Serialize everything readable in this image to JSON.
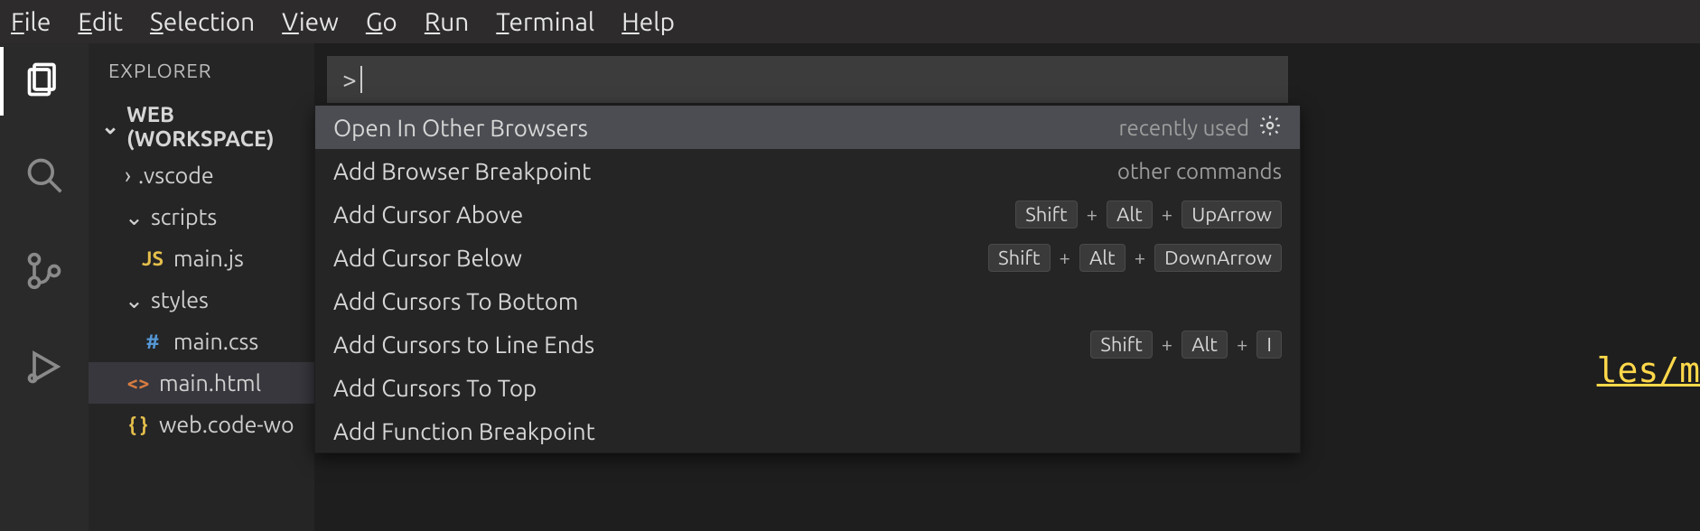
{
  "menubar": {
    "items": [
      "File",
      "Edit",
      "Selection",
      "View",
      "Go",
      "Run",
      "Terminal",
      "Help"
    ]
  },
  "activitybar": {
    "items": [
      {
        "name": "explorer-icon",
        "active": true
      },
      {
        "name": "search-icon",
        "active": false
      },
      {
        "name": "source-control-icon",
        "active": false
      },
      {
        "name": "run-debug-icon",
        "active": false
      }
    ]
  },
  "sidebar": {
    "title": "EXPLORER",
    "section_label": "WEB (WORKSPACE)",
    "tree": [
      {
        "kind": "folder",
        "name": ".vscode",
        "expanded": false,
        "depth": 1
      },
      {
        "kind": "folder",
        "name": "scripts",
        "expanded": true,
        "depth": 1
      },
      {
        "kind": "file",
        "name": "main.js",
        "icon": "JS",
        "icon_class": "ic-js",
        "depth": 2
      },
      {
        "kind": "folder",
        "name": "styles",
        "expanded": true,
        "depth": 1
      },
      {
        "kind": "file",
        "name": "main.css",
        "icon": "#",
        "icon_class": "ic-css",
        "depth": 2
      },
      {
        "kind": "file",
        "name": "main.html",
        "icon": "<>",
        "icon_class": "ic-html",
        "depth": 1,
        "selected": true
      },
      {
        "kind": "file",
        "name": "web.code-workspace",
        "display": "web.code-wo",
        "icon": "{ }",
        "icon_class": "ic-json",
        "depth": 1
      }
    ]
  },
  "command_palette": {
    "prefix": ">",
    "hint_recent": "recently used",
    "hint_other": "other commands",
    "items": [
      {
        "label": "Open In Other Browsers",
        "selected": true,
        "right_hint": "recent",
        "gear": true
      },
      {
        "label": "Add Browser Breakpoint",
        "right_hint": "other"
      },
      {
        "label": "Add Cursor Above",
        "keys": [
          "Shift",
          "Alt",
          "UpArrow"
        ]
      },
      {
        "label": "Add Cursor Below",
        "keys": [
          "Shift",
          "Alt",
          "DownArrow"
        ]
      },
      {
        "label": "Add Cursors To Bottom"
      },
      {
        "label": "Add Cursors to Line Ends",
        "keys": [
          "Shift",
          "Alt",
          "I"
        ]
      },
      {
        "label": "Add Cursors To Top"
      },
      {
        "label": "Add Function Breakpoint"
      }
    ]
  },
  "editor": {
    "visible_code_fragment": "les/m"
  }
}
